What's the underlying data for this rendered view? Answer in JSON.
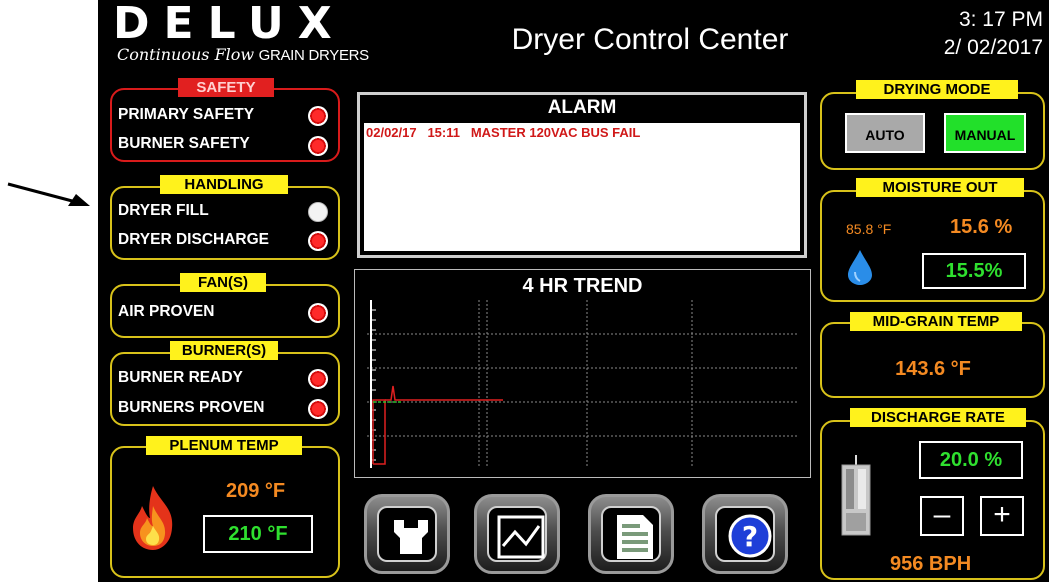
{
  "header": {
    "logo_text": "DELUX",
    "logo_subtitle_script": "Continuous Flow",
    "logo_subtitle_plain": "GRAIN DRYERS",
    "title": "Dryer Control Center",
    "time": "3: 17 PM",
    "date": "2/ 02/2017"
  },
  "safety": {
    "label": "SAFETY",
    "items": [
      {
        "label": "PRIMARY SAFETY",
        "status": "red"
      },
      {
        "label": "BURNER SAFETY",
        "status": "red"
      }
    ]
  },
  "handling": {
    "label": "HANDLING",
    "items": [
      {
        "label": "DRYER FILL",
        "status": "off"
      },
      {
        "label": "DRYER DISCHARGE",
        "status": "red"
      }
    ]
  },
  "fans": {
    "label": "FAN(S)",
    "items": [
      {
        "label": "AIR PROVEN",
        "status": "red"
      }
    ]
  },
  "burners": {
    "label": "BURNER(S)",
    "items": [
      {
        "label": "BURNER READY",
        "status": "red"
      },
      {
        "label": "BURNERS PROVEN",
        "status": "red"
      }
    ]
  },
  "plenum": {
    "label": "PLENUM TEMP",
    "actual": "209 °F",
    "setpoint": "210 °F"
  },
  "alarm": {
    "title": "ALARM",
    "entries": [
      {
        "date": "02/02/17",
        "time": "15:11",
        "message": "MASTER 120VAC BUS FAIL"
      }
    ]
  },
  "trend": {
    "title": "4 HR TREND"
  },
  "nav": {
    "buttons": [
      "settings",
      "trend",
      "report",
      "help"
    ]
  },
  "drying_mode": {
    "label": "DRYING MODE",
    "auto_label": "AUTO",
    "manual_label": "MANUAL",
    "selected": "MANUAL"
  },
  "moisture_out": {
    "label": "MOISTURE OUT",
    "temperature": "85.8 °F",
    "actual": "15.6 %",
    "setpoint": "15.5%"
  },
  "mid_grain": {
    "label": "MID-GRAIN TEMP",
    "value": "143.6 °F"
  },
  "discharge_rate": {
    "label": "DISCHARGE RATE",
    "rate": "20.0 %",
    "minus_label": "–",
    "plus_label": "+",
    "bph": "956 BPH"
  },
  "colors": {
    "panel_border": "#d8c21a",
    "label_bg": "#fff21c",
    "alarm_text": "#d01818",
    "value_green": "#2fe02f",
    "value_orange": "#f48a22",
    "indicator_red": "#ff2a2a",
    "manual_active": "#22e02a",
    "auto_inactive": "#a9a9a9"
  }
}
